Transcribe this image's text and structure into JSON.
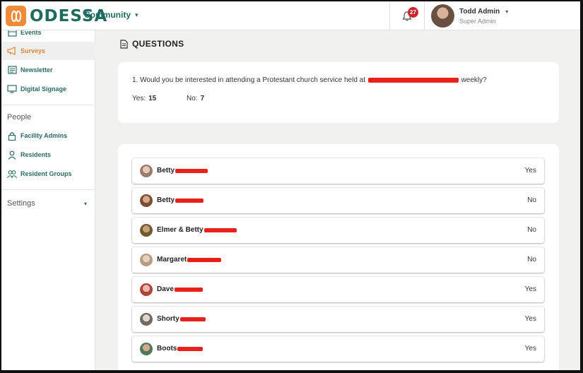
{
  "header": {
    "brand": "ODESSA",
    "community_label": "Community",
    "notifications_count": "27",
    "user_name": "Todd Admin",
    "user_role": "Super Admin"
  },
  "sidebar": {
    "items": [
      {
        "label": "Events",
        "icon": "calendar-icon"
      },
      {
        "label": "Surveys",
        "icon": "megaphone-icon",
        "active": true
      },
      {
        "label": "Newsletter",
        "icon": "newspaper-icon"
      },
      {
        "label": "Digital Signage",
        "icon": "monitor-icon"
      }
    ],
    "people_heading": "People",
    "people_items": [
      {
        "label": "Facility Admins",
        "icon": "lock-icon"
      },
      {
        "label": "Residents",
        "icon": "person-icon"
      },
      {
        "label": "Resident Groups",
        "icon": "group-icon"
      }
    ],
    "settings_label": "Settings"
  },
  "main": {
    "title": "QUESTIONS",
    "question": {
      "text_before": "1. Would you be interested in attending a Protestant church service held at",
      "text_after": "weekly?",
      "yes_label": "Yes:",
      "yes_count": "15",
      "no_label": "No:",
      "no_count": "7"
    },
    "responses": [
      {
        "name": "Betty",
        "answer": "Yes"
      },
      {
        "name": "Betty",
        "answer": "No"
      },
      {
        "name": "Elmer & Betty",
        "answer": "No"
      },
      {
        "name": "Margaret",
        "answer": "No"
      },
      {
        "name": "Dave",
        "answer": "Yes"
      },
      {
        "name": "Shorty",
        "answer": "Yes"
      },
      {
        "name": "Boots",
        "answer": "Yes"
      }
    ]
  },
  "colors": {
    "brand_green": "#1f6b5e",
    "accent_orange": "#ee8b3a",
    "badge_red": "#c9262c",
    "redaction_red": "#e8221b"
  }
}
